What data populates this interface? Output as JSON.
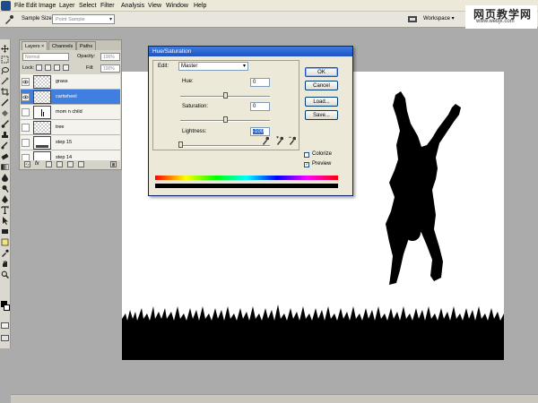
{
  "menubar": {
    "items": [
      "File",
      "Edit",
      "Image",
      "Layer",
      "Select",
      "Filter",
      "Analysis",
      "View",
      "Window",
      "Help"
    ]
  },
  "options": {
    "sample_size_label": "Sample Size:",
    "sample_size_value": "Point Sample",
    "workspace_label": "Workspace ▾"
  },
  "brand": {
    "line1": "网页教学网",
    "line2": "www.webjx.com"
  },
  "layers_panel": {
    "tabs": [
      "Layers ×",
      "Channels",
      "Paths"
    ],
    "blend_mode": "Normal",
    "opacity_label": "Opacity:",
    "opacity_value": "100%",
    "lock_label": "Lock:",
    "fill_label": "Fill:",
    "fill_value": "100%",
    "layers": [
      {
        "name": "grass",
        "visible": true,
        "selected": false
      },
      {
        "name": "cartwheel",
        "visible": true,
        "selected": true
      },
      {
        "name": "mom n child",
        "visible": false,
        "selected": false
      },
      {
        "name": "tree",
        "visible": false,
        "selected": false
      },
      {
        "name": "step 15",
        "visible": false,
        "selected": false
      },
      {
        "name": "step 14",
        "visible": false,
        "selected": false
      }
    ],
    "footer_link_label": "fx"
  },
  "dialog": {
    "title": "Hue/Saturation",
    "edit_label": "Edit:",
    "edit_value": "Master",
    "hue_label": "Hue:",
    "hue_value": "0",
    "saturation_label": "Saturation:",
    "saturation_value": "0",
    "lightness_label": "Lightness:",
    "lightness_value": "-100",
    "hue_level": 0.5,
    "saturation_level": 0.5,
    "lightness_level": 0.0,
    "ok_label": "OK",
    "cancel_label": "Cancel",
    "load_label": "Load...",
    "save_label": "Save...",
    "colorize_label": "Colorize",
    "colorize_checked": false,
    "preview_label": "Preview",
    "preview_checked": true
  },
  "colors": {
    "selection_blue": "#3f7fe0",
    "titlebar_blue": "#1d52c4",
    "workspace_gray": "#ababab"
  }
}
